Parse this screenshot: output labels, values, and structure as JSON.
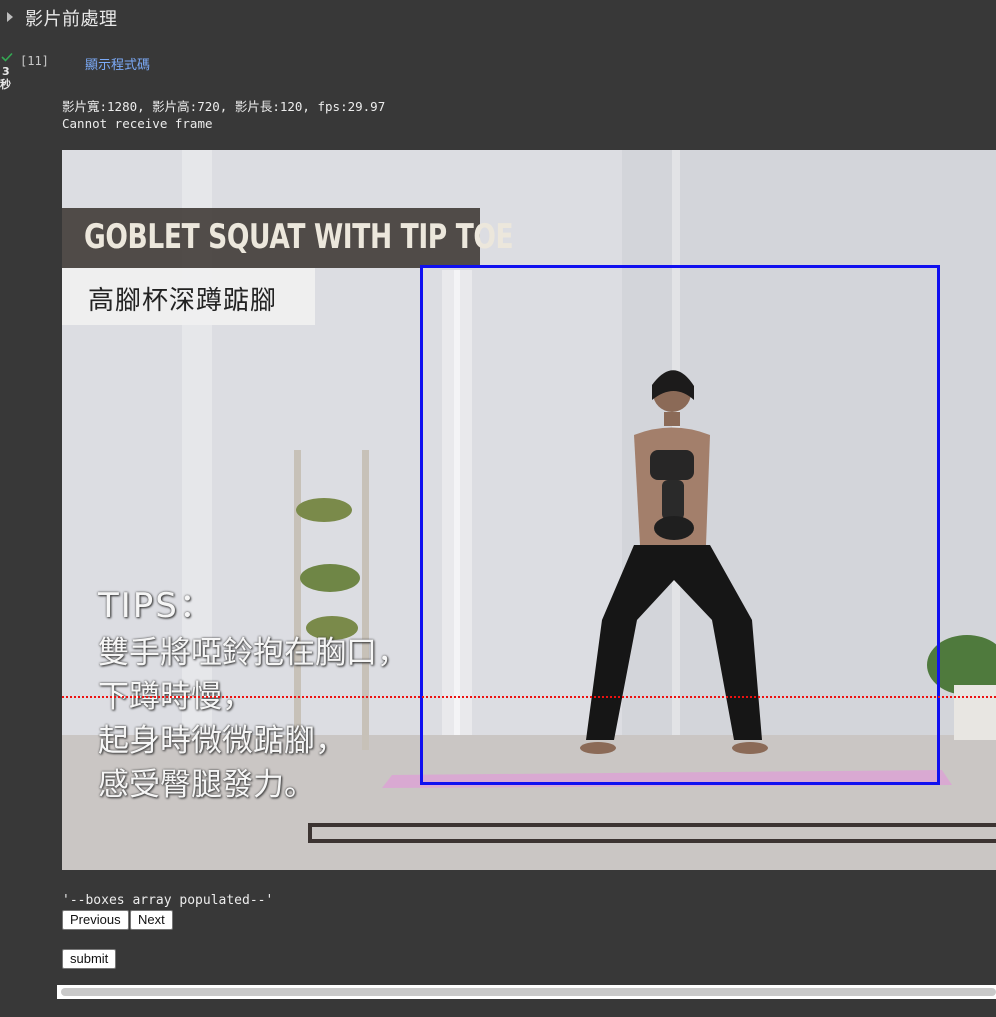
{
  "section": {
    "title": "影片前處理"
  },
  "cell": {
    "execution_count": "[11]",
    "run_time_value": "3",
    "run_time_unit": "秒",
    "show_code_label": "顯示程式碼"
  },
  "output": {
    "line1": "影片寬:1280, 影片高:720, 影片長:120, fps:29.97",
    "line2": "Cannot receive frame"
  },
  "video_frame": {
    "title_en": "GOBLET SQUAT WITH TIP TOE",
    "title_zh": "高腳杯深蹲踮腳",
    "tips_title": "TIPS：",
    "tips_lines": [
      "雙手將啞鈴抱在胸口，",
      "下蹲時慢，",
      "起身時微微踮腳，",
      "感受臀腿發力。"
    ],
    "bbox_color": "#1010f0",
    "ref_line_color": "#e11111"
  },
  "controls": {
    "status": "'--boxes array populated--'",
    "previous_label": "Previous",
    "next_label": "Next",
    "submit_label": "submit"
  },
  "colors": {
    "background": "#383838",
    "link": "#7baaf7",
    "success_check": "#34a853"
  }
}
